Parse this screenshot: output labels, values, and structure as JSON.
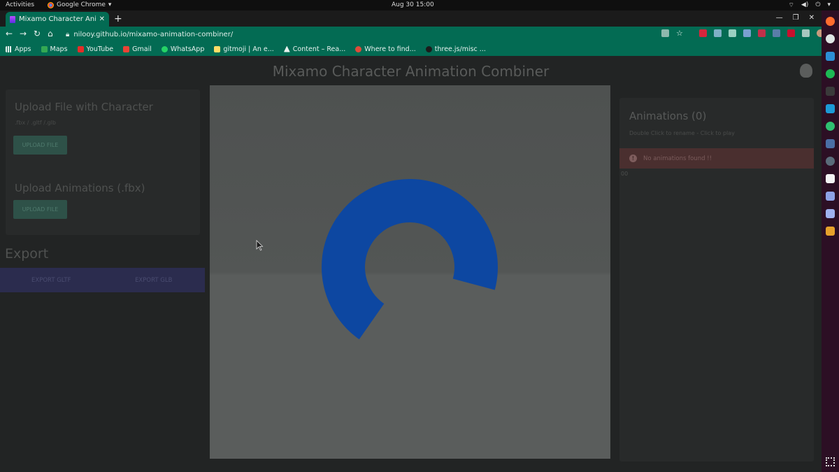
{
  "os": {
    "activities": "Activities",
    "app_name": "Google Chrome",
    "clock": "Aug 30  15:00"
  },
  "browser": {
    "tab_title": "Mixamo Character Anima",
    "url": "nilooy.github.io/mixamo-animation-combiner/",
    "bookmarks": [
      "Apps",
      "Maps",
      "YouTube",
      "Gmail",
      "WhatsApp",
      "gitmoji | An e...",
      "Content – Rea...",
      "Where to find...",
      "three.js/misc ..."
    ],
    "tab_color": "#036b53"
  },
  "page": {
    "title": "Mixamo Character Animation Combiner",
    "upload_character": {
      "heading": "Upload File with Character",
      "formats": ".fbx / .gltf /.glb",
      "button": "UPLOAD FILE"
    },
    "upload_animations": {
      "heading": "Upload Animations (.fbx)",
      "button": "UPLOAD FILE"
    },
    "export": {
      "heading": "Export",
      "gltf_button": "EXPORT GLTF",
      "glb_button": "EXPORT GLB"
    },
    "animations": {
      "heading": "Animations (0)",
      "hint": "Double Click to rename - Click to play",
      "alert": "No animations found !!",
      "counter": "00"
    },
    "spinner_color": "#0d47a1"
  }
}
